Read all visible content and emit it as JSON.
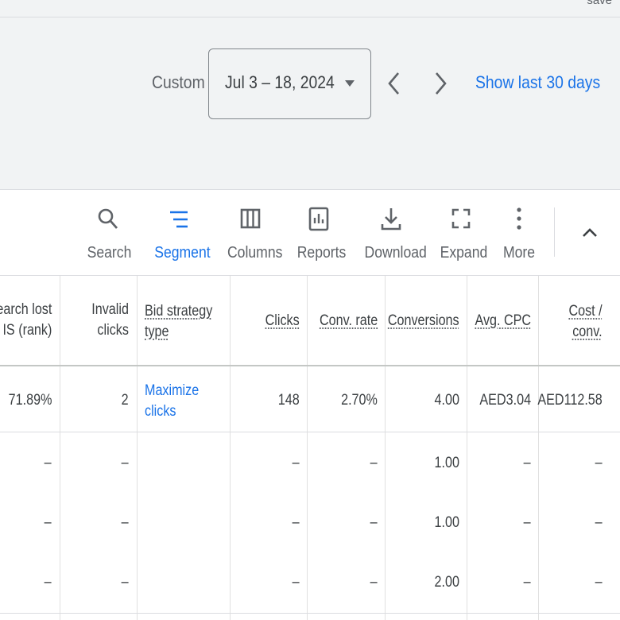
{
  "top_fragment": "save",
  "date_range": {
    "preset_label": "Custom",
    "value": "Jul 3 – 18, 2024",
    "show_last_label": "Show last 30 days"
  },
  "toolbar": {
    "search": "Search",
    "segment": "Segment",
    "columns": "Columns",
    "reports": "Reports",
    "download": "Download",
    "expand": "Expand",
    "more": "More"
  },
  "table": {
    "headers": {
      "search_lost_is_1": "earch lost",
      "search_lost_is_2": "IS (rank)",
      "invalid_clicks_1": "Invalid",
      "invalid_clicks_2": "clicks",
      "bid_strategy_1": "Bid strategy",
      "bid_strategy_2": "type",
      "clicks": "Clicks",
      "conv_rate": "Conv. rate",
      "conversions": "Conversions",
      "avg_cpc": "Avg. CPC",
      "cost_conv_1": "Cost /",
      "cost_conv_2": "conv."
    },
    "summary_row": {
      "search_lost_is": "71.89%",
      "invalid_clicks": "2",
      "bid_strategy_1": "Maximize",
      "bid_strategy_2": "clicks",
      "clicks": "148",
      "conv_rate": "2.70%",
      "conversions": "4.00",
      "avg_cpc": "AED3.04",
      "cost_conv": "AED112.58"
    },
    "rows": [
      {
        "search_lost_is": "–",
        "invalid_clicks": "–",
        "clicks": "–",
        "conv_rate": "–",
        "conversions": "1.00",
        "avg_cpc": "–",
        "cost_conv": "–"
      },
      {
        "search_lost_is": "–",
        "invalid_clicks": "–",
        "clicks": "–",
        "conv_rate": "–",
        "conversions": "1.00",
        "avg_cpc": "–",
        "cost_conv": "–"
      },
      {
        "search_lost_is": "–",
        "invalid_clicks": "–",
        "clicks": "–",
        "conv_rate": "–",
        "conversions": "2.00",
        "avg_cpc": "–",
        "cost_conv": "–"
      }
    ]
  },
  "colors": {
    "accent": "#1a73e8",
    "text": "#3c4043",
    "muted": "#5f6368",
    "background": "#f1f3f4"
  }
}
